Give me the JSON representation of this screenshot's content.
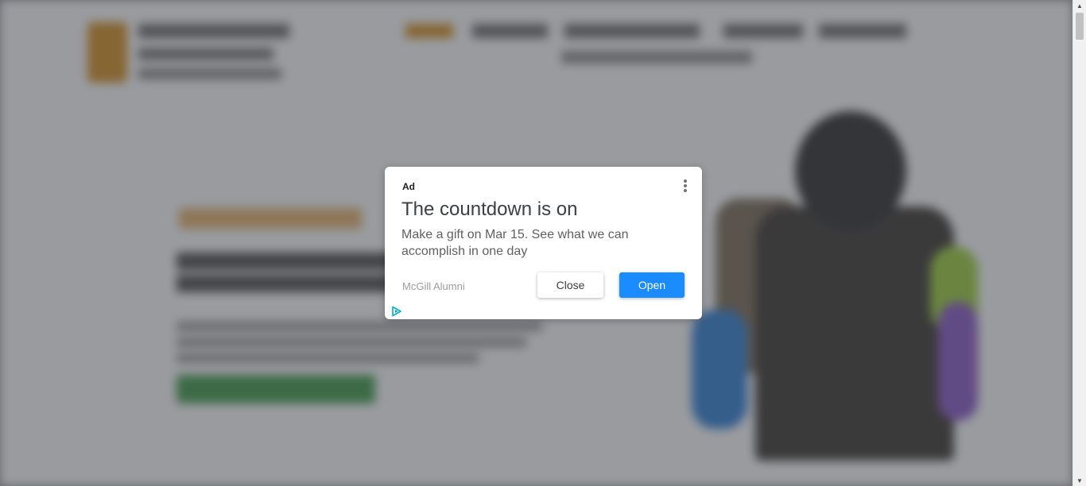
{
  "ad": {
    "label": "Ad",
    "title": "The countdown is on",
    "description": "Make a gift on Mar 15. See what we can accomplish in one day",
    "advertiser": "McGill Alumni",
    "close_label": "Close",
    "open_label": "Open",
    "menu_icon": "more-vert-icon",
    "adchoices_icon": "adchoices-icon"
  },
  "colors": {
    "open_button": "#1a8cff",
    "overlay": "#5a5e64",
    "adchoices": "#00aecd"
  },
  "scrollbar": {
    "up_icon": "arrow-up-icon",
    "down_icon": "arrow-down-icon"
  }
}
